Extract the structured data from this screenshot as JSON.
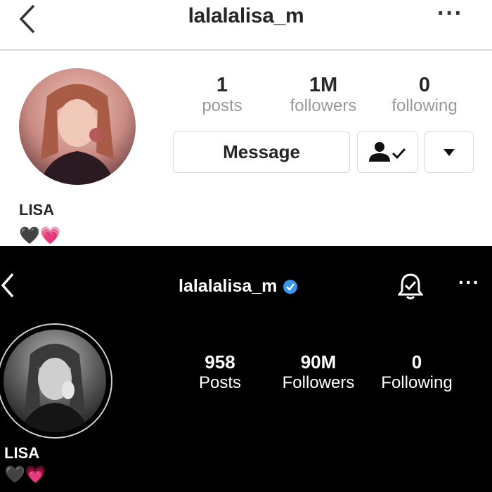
{
  "old_profile": {
    "username": "lalalalisa_m",
    "stats": [
      {
        "value": "1",
        "label": "posts"
      },
      {
        "value": "1M",
        "label": "followers"
      },
      {
        "value": "0",
        "label": "following"
      }
    ],
    "message_button": "Message",
    "display_name": "LISA",
    "bio_hearts": "🖤💗",
    "icons": {
      "back": "chevron-left-icon",
      "more": "more-horizontal-icon",
      "following": "person-check-icon",
      "dropdown": "caret-down-icon"
    }
  },
  "new_profile": {
    "username": "lalalalisa_m",
    "verified": true,
    "stats": [
      {
        "value": "958",
        "label": "Posts"
      },
      {
        "value": "90M",
        "label": "Followers"
      },
      {
        "value": "0",
        "label": "Following"
      }
    ],
    "display_name": "LISA",
    "bio_hearts": "🖤💗",
    "icons": {
      "back": "chevron-left-icon",
      "notifications": "bell-check-icon",
      "more": "more-horizontal-icon",
      "verified": "verified-badge-icon"
    }
  },
  "colors": {
    "verified_blue": "#3897f0",
    "old_bg": "#ffffff",
    "new_bg": "#000000"
  }
}
